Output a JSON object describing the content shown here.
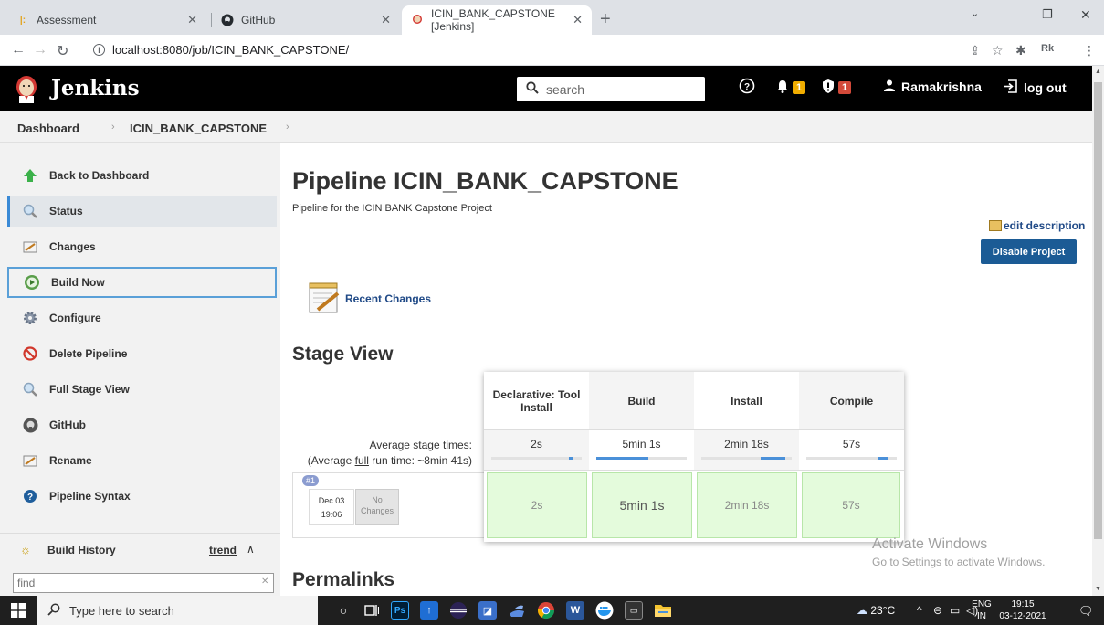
{
  "browser": {
    "tabs": [
      {
        "label": "Assessment"
      },
      {
        "label": "GitHub"
      },
      {
        "label": "ICIN_BANK_CAPSTONE [Jenkins]"
      }
    ],
    "url": "localhost:8080/job/ICIN_BANK_CAPSTONE/"
  },
  "header": {
    "title": "Jenkins",
    "search_placeholder": "search",
    "notif_count": "1",
    "security_count": "1",
    "user": "Ramakrishna",
    "logout": "log out"
  },
  "breadcrumb": [
    "Dashboard",
    "ICIN_BANK_CAPSTONE"
  ],
  "sidebar": {
    "items": [
      {
        "label": "Back to Dashboard"
      },
      {
        "label": "Status"
      },
      {
        "label": "Changes"
      },
      {
        "label": "Build Now"
      },
      {
        "label": "Configure"
      },
      {
        "label": "Delete Pipeline"
      },
      {
        "label": "Full Stage View"
      },
      {
        "label": "GitHub"
      },
      {
        "label": "Rename"
      },
      {
        "label": "Pipeline Syntax"
      }
    ],
    "build_history": "Build History",
    "trend": "trend",
    "find_placeholder": "find"
  },
  "main": {
    "title": "Pipeline ICIN_BANK_CAPSTONE",
    "description": "Pipeline for the ICIN BANK Capstone Project",
    "edit_description": "edit description",
    "disable_project": "Disable Project",
    "recent_changes": "Recent Changes",
    "stage_view_title": "Stage View",
    "permalinks_title": "Permalinks"
  },
  "stage_view": {
    "avg_label": "Average stage times:",
    "avg_full_prefix": "(Average ",
    "avg_full_link": "full",
    "avg_full_suffix": " run time: ~8min 41s)",
    "stages": [
      {
        "name": "Declarative: Tool Install",
        "avg": "2s",
        "run": "2s",
        "avg_fill": 0.05
      },
      {
        "name": "Build",
        "avg": "5min 1s",
        "run": "5min 1s",
        "avg_fill": 0.58
      },
      {
        "name": "Install",
        "avg": "2min 18s",
        "run": "2min 18s",
        "avg_fill": 0.27
      },
      {
        "name": "Compile",
        "avg": "57s",
        "run": "57s",
        "avg_fill": 0.11
      }
    ],
    "build": {
      "number": "#1",
      "date": "Dec 03",
      "time": "19:06",
      "changes": "No Changes"
    }
  },
  "watermark": {
    "line1": "Activate Windows",
    "line2": "Go to Settings to activate Windows."
  },
  "taskbar": {
    "search_placeholder": "Type here to search",
    "weather": "23°C",
    "lang": "ENG",
    "region": "IN",
    "time": "19:15",
    "date": "03-12-2021"
  }
}
